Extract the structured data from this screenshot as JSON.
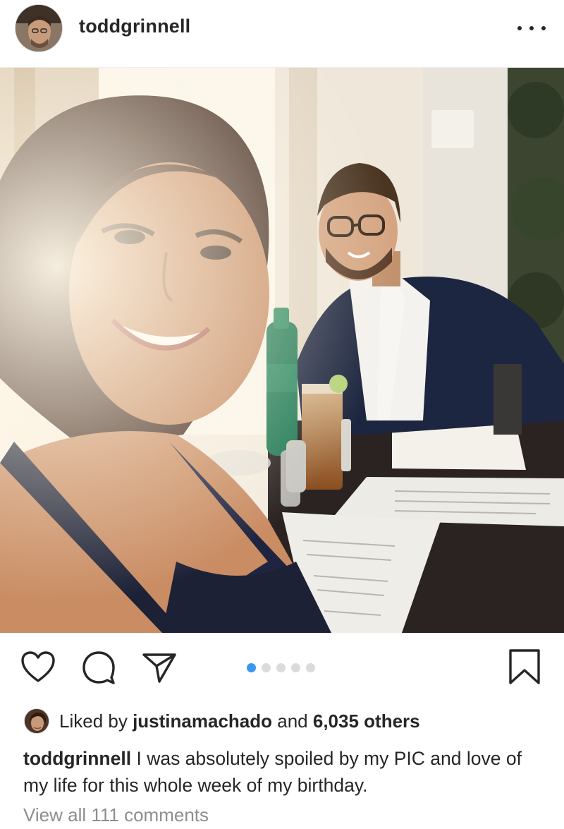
{
  "post": {
    "username": "toddgrinnell",
    "more_icon": "more-horizontal-icon"
  },
  "actions": {
    "like_icon": "heart-icon",
    "comment_icon": "comment-icon",
    "share_icon": "send-icon",
    "save_icon": "bookmark-icon",
    "carousel_count": 5,
    "carousel_active": 1,
    "accent": "#3897f0"
  },
  "likes": {
    "prefix": "Liked by",
    "user": "justinamachado",
    "and": "and",
    "count": "6,035 others"
  },
  "caption": {
    "username": "toddgrinnell",
    "text": "I was absolutely spoiled by my PIC and love of my life for this whole week of my birthday."
  },
  "comments": {
    "view_all": "View all 111 comments"
  }
}
